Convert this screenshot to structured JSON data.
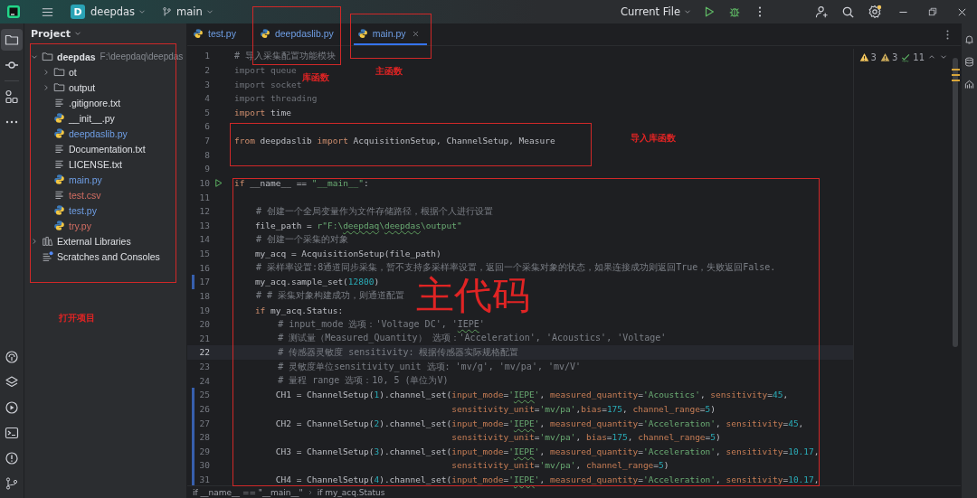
{
  "title_bar": {
    "project_badge": "D",
    "project": "deepdas",
    "branch": "main",
    "run_config": "Current File"
  },
  "tool_windows": [
    {
      "kind": "project",
      "selected": true
    },
    {
      "kind": "commit",
      "selected": false
    },
    {
      "kind": "structure",
      "selected": false
    },
    {
      "kind": "more",
      "selected": false
    },
    {
      "kind": "packages",
      "selected": false
    },
    {
      "kind": "layers",
      "selected": false
    },
    {
      "kind": "run",
      "selected": false
    },
    {
      "kind": "terminal",
      "selected": false
    },
    {
      "kind": "problems",
      "selected": false
    },
    {
      "kind": "git",
      "selected": false
    }
  ],
  "project_panel": {
    "title": "Project",
    "tree": [
      {
        "name": "deepdas",
        "path": "F:\\deepdaq\\deepdas",
        "kind": "folder",
        "modified": false,
        "untracked": false,
        "expanded": true,
        "children": [
          {
            "name": "ot",
            "kind": "folder",
            "modified": false,
            "untracked": false,
            "expanded": false
          },
          {
            "name": "output",
            "kind": "folder",
            "modified": false,
            "untracked": false,
            "expanded": false
          },
          {
            "name": ".gitignore.txt",
            "kind": "text",
            "modified": false,
            "untracked": false
          },
          {
            "name": "__init__.py",
            "kind": "python",
            "modified": false,
            "untracked": false
          },
          {
            "name": "deepdaslib.py",
            "kind": "python",
            "modified": true,
            "untracked": false
          },
          {
            "name": "Documentation.txt",
            "kind": "text",
            "modified": false,
            "untracked": false
          },
          {
            "name": "LICENSE.txt",
            "kind": "text",
            "modified": false,
            "untracked": false
          },
          {
            "name": "main.py",
            "kind": "python",
            "modified": true,
            "untracked": false
          },
          {
            "name": "test.csv",
            "kind": "text",
            "modified": false,
            "untracked": true
          },
          {
            "name": "test.py",
            "kind": "python",
            "modified": true,
            "untracked": false
          },
          {
            "name": "try.py",
            "kind": "python",
            "modified": false,
            "untracked": true
          }
        ]
      },
      {
        "name": "External Libraries",
        "kind": "library",
        "modified": false,
        "untracked": false,
        "expanded": false
      },
      {
        "name": "Scratches and Consoles",
        "kind": "scratches",
        "modified": false,
        "untracked": false
      }
    ]
  },
  "tabs": [
    {
      "label": "test.py",
      "modified": true,
      "selected": false
    },
    {
      "label": "deepdaslib.py",
      "modified": true,
      "selected": false
    },
    {
      "label": "main.py",
      "modified": true,
      "selected": true
    }
  ],
  "inspections": {
    "warnings": "3",
    "weak_warnings": "3",
    "typos": "11"
  },
  "lines": [
    {
      "number": "1",
      "current": false,
      "tokens": [
        {
          "kind": "comment",
          "text": "# 导入采集配置功能模块"
        }
      ]
    },
    {
      "number": "2",
      "current": false,
      "tokens": [
        {
          "kind": "unused",
          "text": "import queue"
        }
      ]
    },
    {
      "number": "3",
      "current": false,
      "tokens": [
        {
          "kind": "unused",
          "text": "import socket"
        }
      ]
    },
    {
      "number": "4",
      "current": false,
      "tokens": [
        {
          "kind": "unused",
          "text": "import threading"
        }
      ]
    },
    {
      "number": "5",
      "current": false,
      "tokens": [
        {
          "kind": "keyword",
          "text": "import"
        },
        {
          "kind": "plain",
          "text": " time"
        }
      ]
    },
    {
      "number": "6",
      "current": false
    },
    {
      "number": "7",
      "current": false,
      "tokens": [
        {
          "kind": "keyword",
          "text": "from"
        },
        {
          "kind": "plain",
          "text": " deepdaslib "
        },
        {
          "kind": "keyword",
          "text": "import"
        },
        {
          "kind": "plain",
          "text": " AcquisitionSetup, ChannelSetup, Measure"
        }
      ]
    },
    {
      "number": "8",
      "current": false
    },
    {
      "number": "9",
      "current": false
    },
    {
      "number": "10",
      "current": false,
      "runnable": true,
      "tokens": [
        {
          "kind": "keyword",
          "text": "if"
        },
        {
          "kind": "plain",
          "text": " __name__ == "
        },
        {
          "kind": "string",
          "text": "\"__main__\""
        },
        {
          "kind": "plain",
          "text": ":"
        }
      ]
    },
    {
      "number": "11",
      "current": false
    },
    {
      "number": "12",
      "current": false,
      "tokens": [
        {
          "kind": "comment",
          "text": "    # 创建一个全局变量作为文件存储路径，根据个人进行设置"
        }
      ]
    },
    {
      "number": "13",
      "current": false,
      "tokens": [
        {
          "kind": "plain",
          "text": "    file_path = "
        },
        {
          "kind": "string",
          "text": "r\"F:\\"
        },
        {
          "kind": "string-typo",
          "text": "deepdaq"
        },
        {
          "kind": "string",
          "text": "\\"
        },
        {
          "kind": "string-typo",
          "text": "deepdas"
        },
        {
          "kind": "string",
          "text": "\\output\""
        }
      ]
    },
    {
      "number": "14",
      "current": false,
      "tokens": [
        {
          "kind": "comment",
          "text": "    # 创建一个采集的对象"
        }
      ]
    },
    {
      "number": "15",
      "current": false,
      "tokens": [
        {
          "kind": "plain",
          "text": "    my_acq = AcquisitionSetup(file_path)"
        }
      ]
    },
    {
      "number": "16",
      "current": false,
      "tokens": [
        {
          "kind": "comment",
          "text": "    # 采样率设置:8通道同步采集，暂不支持多采样率设置，返回一个采集对象的状态，如果连接成功则返回True，失败返回False."
        }
      ]
    },
    {
      "number": "17",
      "current": false,
      "changed": true,
      "tokens": [
        {
          "kind": "plain",
          "text": "    my_acq.sample_set("
        },
        {
          "kind": "number",
          "text": "12800"
        },
        {
          "kind": "plain",
          "text": ")"
        }
      ]
    },
    {
      "number": "18",
      "current": false,
      "tokens": [
        {
          "kind": "comment",
          "text": "    # # 采集对象构建成功，则通道配置"
        }
      ]
    },
    {
      "number": "19",
      "current": false,
      "tokens": [
        {
          "kind": "keyword",
          "text": "    if"
        },
        {
          "kind": "plain",
          "text": " my_acq.Status:"
        }
      ]
    },
    {
      "number": "20",
      "current": false,
      "tokens": [
        {
          "kind": "comment",
          "text": "        # input_mode 选项：'Voltage DC', '"
        },
        {
          "kind": "comment-typo",
          "text": "IEPE"
        },
        {
          "kind": "comment",
          "text": "'"
        }
      ]
    },
    {
      "number": "21",
      "current": false,
      "tokens": [
        {
          "kind": "comment",
          "text": "        # 测试量（Measured_Quantity） 选项：'Acceleration', 'Acoustics', 'Voltage'"
        }
      ]
    },
    {
      "number": "22",
      "current": true,
      "tokens": [
        {
          "kind": "comment",
          "text": "        # 传感器灵敏度 sensitivity: 根据传感器实际规格配置"
        }
      ]
    },
    {
      "number": "23",
      "current": false,
      "tokens": [
        {
          "kind": "comment",
          "text": "        # 灵敏度单位sensitivity_unit 选项: 'mv/g', 'mv/pa', 'mv/V'"
        }
      ]
    },
    {
      "number": "24",
      "current": false,
      "tokens": [
        {
          "kind": "comment",
          "text": "        # 量程 range 选项：10, 5 (单位为V)"
        }
      ]
    },
    {
      "number": "25",
      "current": false,
      "changed": true,
      "tokens": [
        {
          "kind": "plain",
          "text": "        CH1 = ChannelSetup("
        },
        {
          "kind": "number",
          "text": "1"
        },
        {
          "kind": "plain",
          "text": ").channel_set("
        },
        {
          "kind": "param",
          "text": "input_mode"
        },
        {
          "kind": "plain",
          "text": "="
        },
        {
          "kind": "string",
          "text": "'"
        },
        {
          "kind": "string-typo",
          "text": "IEPE"
        },
        {
          "kind": "string",
          "text": "'"
        },
        {
          "kind": "plain",
          "text": ", "
        },
        {
          "kind": "param",
          "text": "measured_quantity"
        },
        {
          "kind": "plain",
          "text": "="
        },
        {
          "kind": "string",
          "text": "'Acoustics'"
        },
        {
          "kind": "plain",
          "text": ", "
        },
        {
          "kind": "param",
          "text": "sensitivity"
        },
        {
          "kind": "plain",
          "text": "="
        },
        {
          "kind": "number",
          "text": "45"
        },
        {
          "kind": "plain",
          "text": ","
        }
      ]
    },
    {
      "number": "26",
      "current": false,
      "changed": true,
      "tokens": [
        {
          "kind": "param",
          "text": "                                          sensitivity_unit"
        },
        {
          "kind": "plain",
          "text": "="
        },
        {
          "kind": "string",
          "text": "'mv/pa'"
        },
        {
          "kind": "plain",
          "text": ","
        },
        {
          "kind": "param",
          "text": "bias"
        },
        {
          "kind": "plain",
          "text": "="
        },
        {
          "kind": "number",
          "text": "175"
        },
        {
          "kind": "plain",
          "text": ", "
        },
        {
          "kind": "param",
          "text": "channel_range"
        },
        {
          "kind": "plain",
          "text": "="
        },
        {
          "kind": "number",
          "text": "5"
        },
        {
          "kind": "plain",
          "text": ")"
        }
      ]
    },
    {
      "number": "27",
      "current": false,
      "changed": true,
      "tokens": [
        {
          "kind": "plain",
          "text": "        CH2 = ChannelSetup("
        },
        {
          "kind": "number",
          "text": "2"
        },
        {
          "kind": "plain",
          "text": ").channel_set("
        },
        {
          "kind": "param",
          "text": "input_mode"
        },
        {
          "kind": "plain",
          "text": "="
        },
        {
          "kind": "string",
          "text": "'"
        },
        {
          "kind": "string-typo",
          "text": "IEPE"
        },
        {
          "kind": "string",
          "text": "'"
        },
        {
          "kind": "plain",
          "text": ", "
        },
        {
          "kind": "param",
          "text": "measured_quantity"
        },
        {
          "kind": "plain",
          "text": "="
        },
        {
          "kind": "string",
          "text": "'Acceleration'"
        },
        {
          "kind": "plain",
          "text": ", "
        },
        {
          "kind": "param",
          "text": "sensitivity"
        },
        {
          "kind": "plain",
          "text": "="
        },
        {
          "kind": "number",
          "text": "45"
        },
        {
          "kind": "plain",
          "text": ","
        }
      ]
    },
    {
      "number": "28",
      "current": false,
      "changed": true,
      "tokens": [
        {
          "kind": "param",
          "text": "                                          sensitivity_unit"
        },
        {
          "kind": "plain",
          "text": "="
        },
        {
          "kind": "string",
          "text": "'mv/pa'"
        },
        {
          "kind": "plain",
          "text": ", "
        },
        {
          "kind": "param",
          "text": "bias"
        },
        {
          "kind": "plain",
          "text": "="
        },
        {
          "kind": "number",
          "text": "175"
        },
        {
          "kind": "plain",
          "text": ", "
        },
        {
          "kind": "param",
          "text": "channel_range"
        },
        {
          "kind": "plain",
          "text": "="
        },
        {
          "kind": "number",
          "text": "5"
        },
        {
          "kind": "plain",
          "text": ")"
        }
      ]
    },
    {
      "number": "29",
      "current": false,
      "changed": true,
      "tokens": [
        {
          "kind": "plain",
          "text": "        CH3 = ChannelSetup("
        },
        {
          "kind": "number",
          "text": "3"
        },
        {
          "kind": "plain",
          "text": ").channel_set("
        },
        {
          "kind": "param",
          "text": "input_mode"
        },
        {
          "kind": "plain",
          "text": "="
        },
        {
          "kind": "string",
          "text": "'"
        },
        {
          "kind": "string-typo",
          "text": "IEPE"
        },
        {
          "kind": "string",
          "text": "'"
        },
        {
          "kind": "plain",
          "text": ", "
        },
        {
          "kind": "param",
          "text": "measured_quantity"
        },
        {
          "kind": "plain",
          "text": "="
        },
        {
          "kind": "string",
          "text": "'Acceleration'"
        },
        {
          "kind": "plain",
          "text": ", "
        },
        {
          "kind": "param",
          "text": "sensitivity"
        },
        {
          "kind": "plain",
          "text": "="
        },
        {
          "kind": "number",
          "text": "10.17"
        },
        {
          "kind": "plain",
          "text": ","
        }
      ]
    },
    {
      "number": "30",
      "current": false,
      "changed": true,
      "tokens": [
        {
          "kind": "param",
          "text": "                                          sensitivity_unit"
        },
        {
          "kind": "plain",
          "text": "="
        },
        {
          "kind": "string",
          "text": "'mv/pa'"
        },
        {
          "kind": "plain",
          "text": ", "
        },
        {
          "kind": "param",
          "text": "channel_range"
        },
        {
          "kind": "plain",
          "text": "="
        },
        {
          "kind": "number",
          "text": "5"
        },
        {
          "kind": "plain",
          "text": ")"
        }
      ]
    },
    {
      "number": "31",
      "current": false,
      "changed": true,
      "tokens": [
        {
          "kind": "plain",
          "text": "        CH4 = ChannelSetup("
        },
        {
          "kind": "number",
          "text": "4"
        },
        {
          "kind": "plain",
          "text": ").channel_set("
        },
        {
          "kind": "param",
          "text": "input_mode"
        },
        {
          "kind": "plain",
          "text": "="
        },
        {
          "kind": "string",
          "text": "'"
        },
        {
          "kind": "string-typo",
          "text": "IEPE"
        },
        {
          "kind": "string",
          "text": "'"
        },
        {
          "kind": "plain",
          "text": ", "
        },
        {
          "kind": "param",
          "text": "measured_quantity"
        },
        {
          "kind": "plain",
          "text": "="
        },
        {
          "kind": "string",
          "text": "'Acceleration'"
        },
        {
          "kind": "plain",
          "text": ", "
        },
        {
          "kind": "param",
          "text": "sensitivity"
        },
        {
          "kind": "plain",
          "text": "="
        },
        {
          "kind": "number",
          "text": "10.17"
        },
        {
          "kind": "plain",
          "text": ","
        }
      ]
    }
  ],
  "breadcrumbs": [
    "if __name__ == \"__main__\"",
    "if my_acq.Status"
  ],
  "annotations": [
    {
      "kind": "frame"
    },
    {
      "kind": "frame"
    },
    {
      "kind": "frame"
    },
    {
      "kind": "frame"
    },
    {
      "kind": "frame"
    },
    {
      "kind": "label",
      "text": "库函数"
    },
    {
      "kind": "label",
      "text": "主函数"
    },
    {
      "kind": "label",
      "text": "导入库函数"
    },
    {
      "kind": "label",
      "text": "主代码"
    },
    {
      "kind": "label",
      "text": "打开项目"
    }
  ]
}
